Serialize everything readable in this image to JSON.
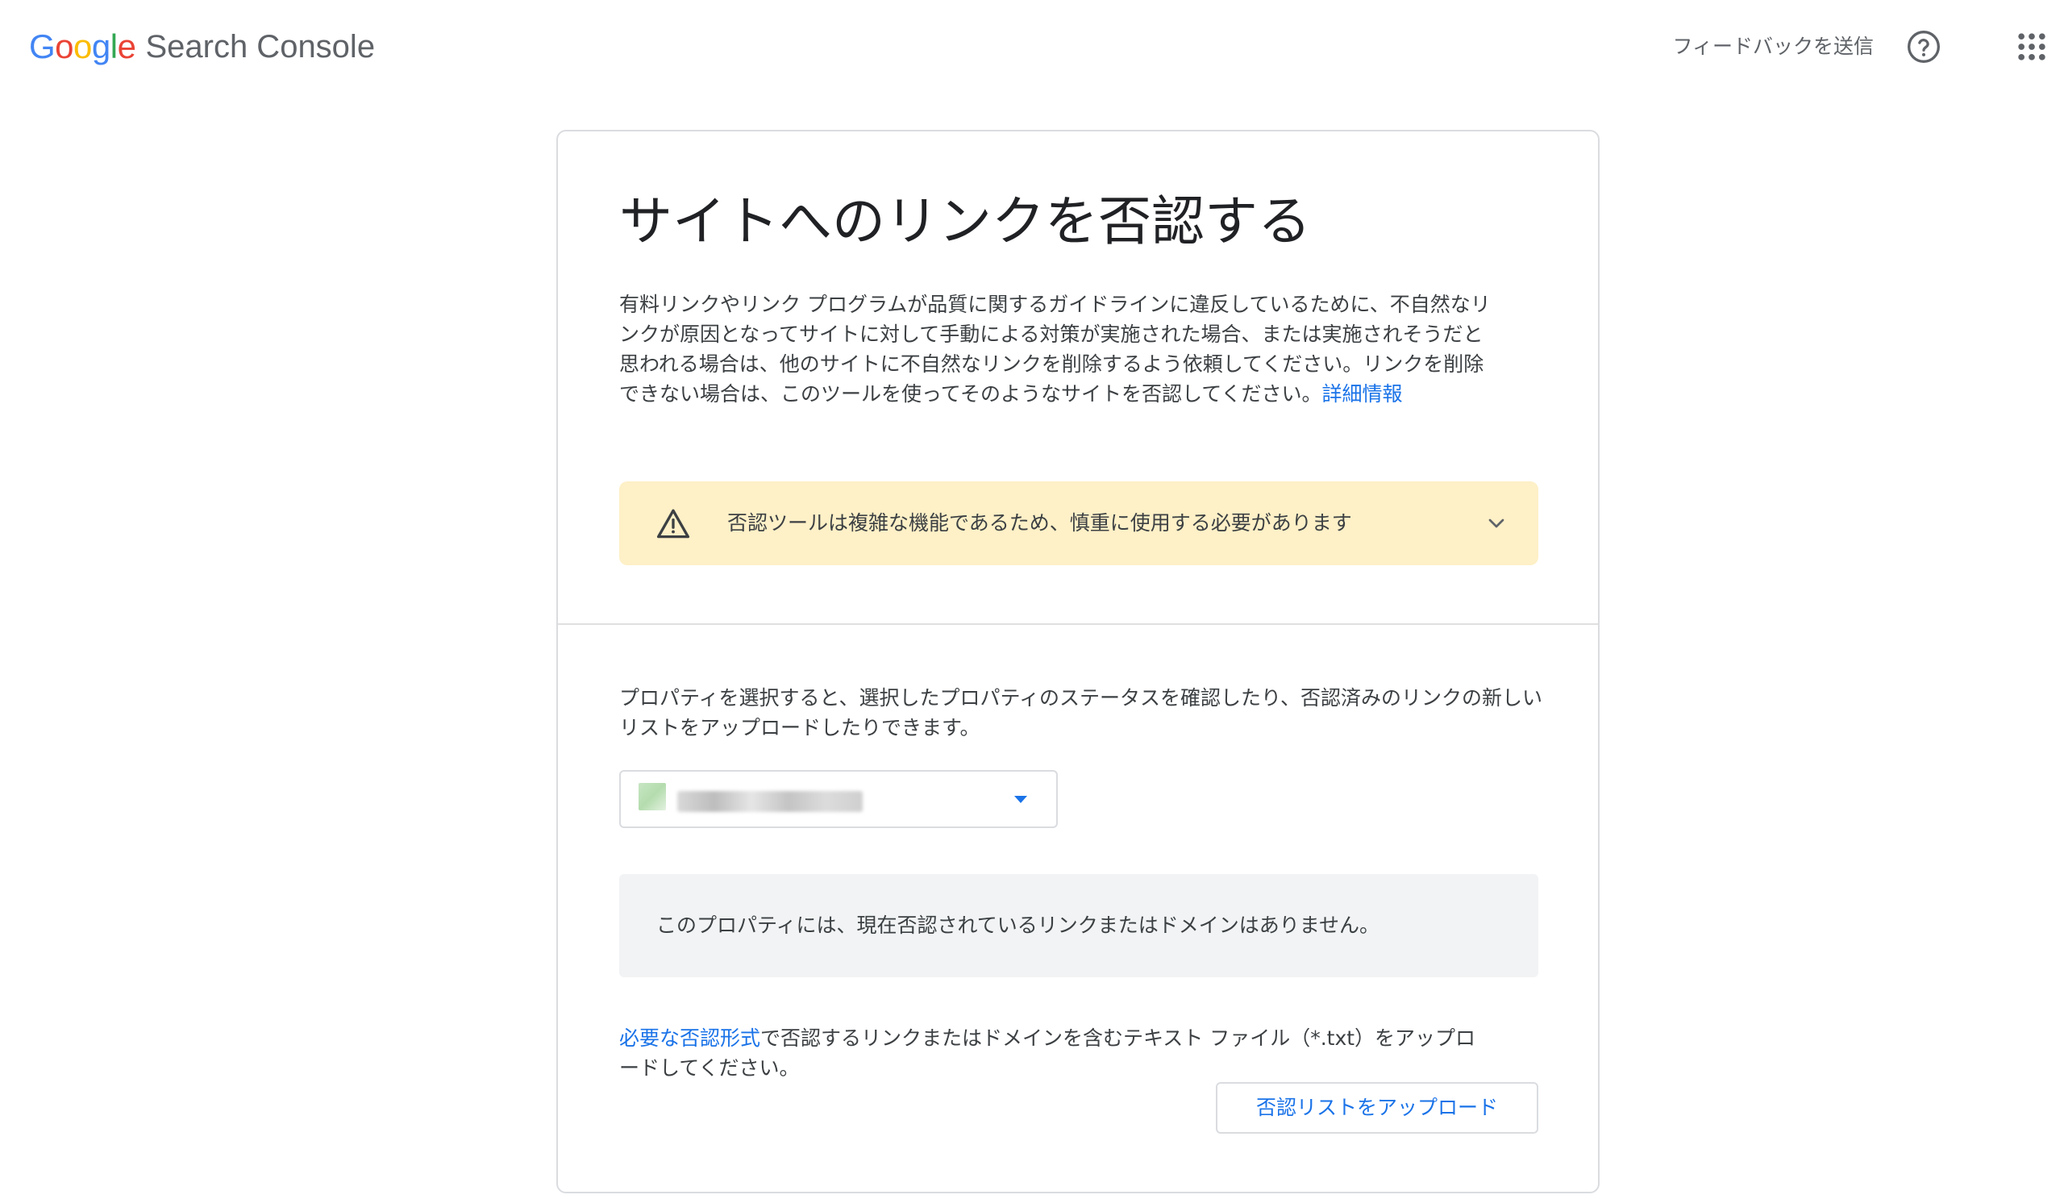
{
  "header": {
    "brand": {
      "G": "G",
      "o1": "o",
      "o2": "o",
      "g": "g",
      "l": "l",
      "e": "e"
    },
    "product": "Search Console",
    "feedback_label": "フィードバックを送信",
    "help_icon": "help-circle-icon",
    "apps_icon": "apps-grid-icon"
  },
  "card": {
    "title": "サイトへのリンクを否認する",
    "intro_text": "有料リンクやリンク プログラムが品質に関するガイドラインに違反しているために、不自然なリンクが原因となってサイトに対して手動による対策が実施された場合、または実施されそうだと思われる場合は、他のサイトに不自然なリンクを削除するよう依頼してください。リンクを削除できない場合は、このツールを使ってそのようなサイトを否認してください。",
    "learn_more": "詳細情報",
    "warning": {
      "text": "否認ツールは複雑な機能であるため、慎重に使用する必要があります",
      "icon": "warning-triangle-icon",
      "expand_icon": "chevron-down-icon"
    },
    "property_description": "プロパティを選択すると、選択したプロパティのステータスを確認したり、否認済みのリンクの新しいリストをアップロードしたりできます。",
    "property_select": {
      "caret_icon": "caret-down-icon"
    },
    "notice": "このプロパティには、現在否認されているリンクまたはドメインはありません。",
    "upload": {
      "format_link": "必要な否認形式",
      "description": "で否認するリンクまたはドメインを含むテキスト ファイル（*.txt）をアップロードしてください。",
      "button_label": "否認リストをアップロード"
    }
  },
  "colors": {
    "google_blue": "#4285F4",
    "google_red": "#EA4335",
    "google_yellow": "#FBBC05",
    "google_green": "#34A853",
    "link": "#1a73e8",
    "warning_bg": "#fef0c7",
    "notice_bg": "#f1f3f4"
  }
}
